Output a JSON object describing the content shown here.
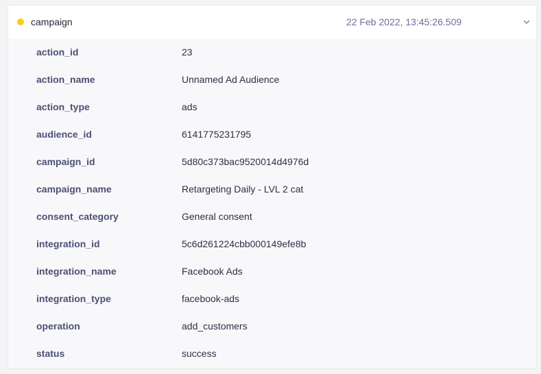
{
  "event": {
    "name": "campaign",
    "timestamp": "22 Feb 2022, 13:45:26.509",
    "status_color": "#f9ce16",
    "expand_icon": "chevron-down-icon"
  },
  "properties": [
    {
      "key": "action_id",
      "value": "23"
    },
    {
      "key": "action_name",
      "value": "Unnamed Ad Audience"
    },
    {
      "key": "action_type",
      "value": "ads"
    },
    {
      "key": "audience_id",
      "value": "6141775231795"
    },
    {
      "key": "campaign_id",
      "value": "5d80c373bac9520014d4976d"
    },
    {
      "key": "campaign_name",
      "value": "Retargeting Daily - LVL 2 cat"
    },
    {
      "key": "consent_category",
      "value": "General consent"
    },
    {
      "key": "integration_id",
      "value": "5c6d261224cbb000149efe8b"
    },
    {
      "key": "integration_name",
      "value": "Facebook Ads"
    },
    {
      "key": "integration_type",
      "value": "facebook-ads"
    },
    {
      "key": "operation",
      "value": "add_customers"
    },
    {
      "key": "status",
      "value": "success"
    }
  ]
}
